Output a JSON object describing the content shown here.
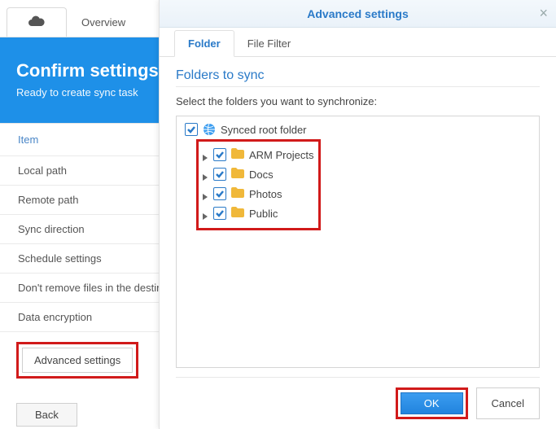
{
  "topbar": {
    "overview_label": "Overview"
  },
  "hero": {
    "title": "Confirm settings",
    "subtitle": "Ready to create sync task"
  },
  "list": {
    "header": "Item",
    "rows": [
      "Local path",
      "Remote path",
      "Sync direction",
      "Schedule settings",
      "Don't remove files in the destination",
      "Data encryption"
    ],
    "advanced_label": "Advanced settings",
    "back_label": "Back"
  },
  "modal": {
    "title": "Advanced settings",
    "tabs": {
      "folder": "Folder",
      "file_filter": "File Filter"
    },
    "section_title": "Folders to sync",
    "description": "Select the folders you want to synchronize:",
    "root_label": "Synced root folder",
    "children": [
      {
        "label": "ARM Projects"
      },
      {
        "label": "Docs"
      },
      {
        "label": "Photos"
      },
      {
        "label": "Public"
      }
    ],
    "ok_label": "OK",
    "cancel_label": "Cancel"
  }
}
